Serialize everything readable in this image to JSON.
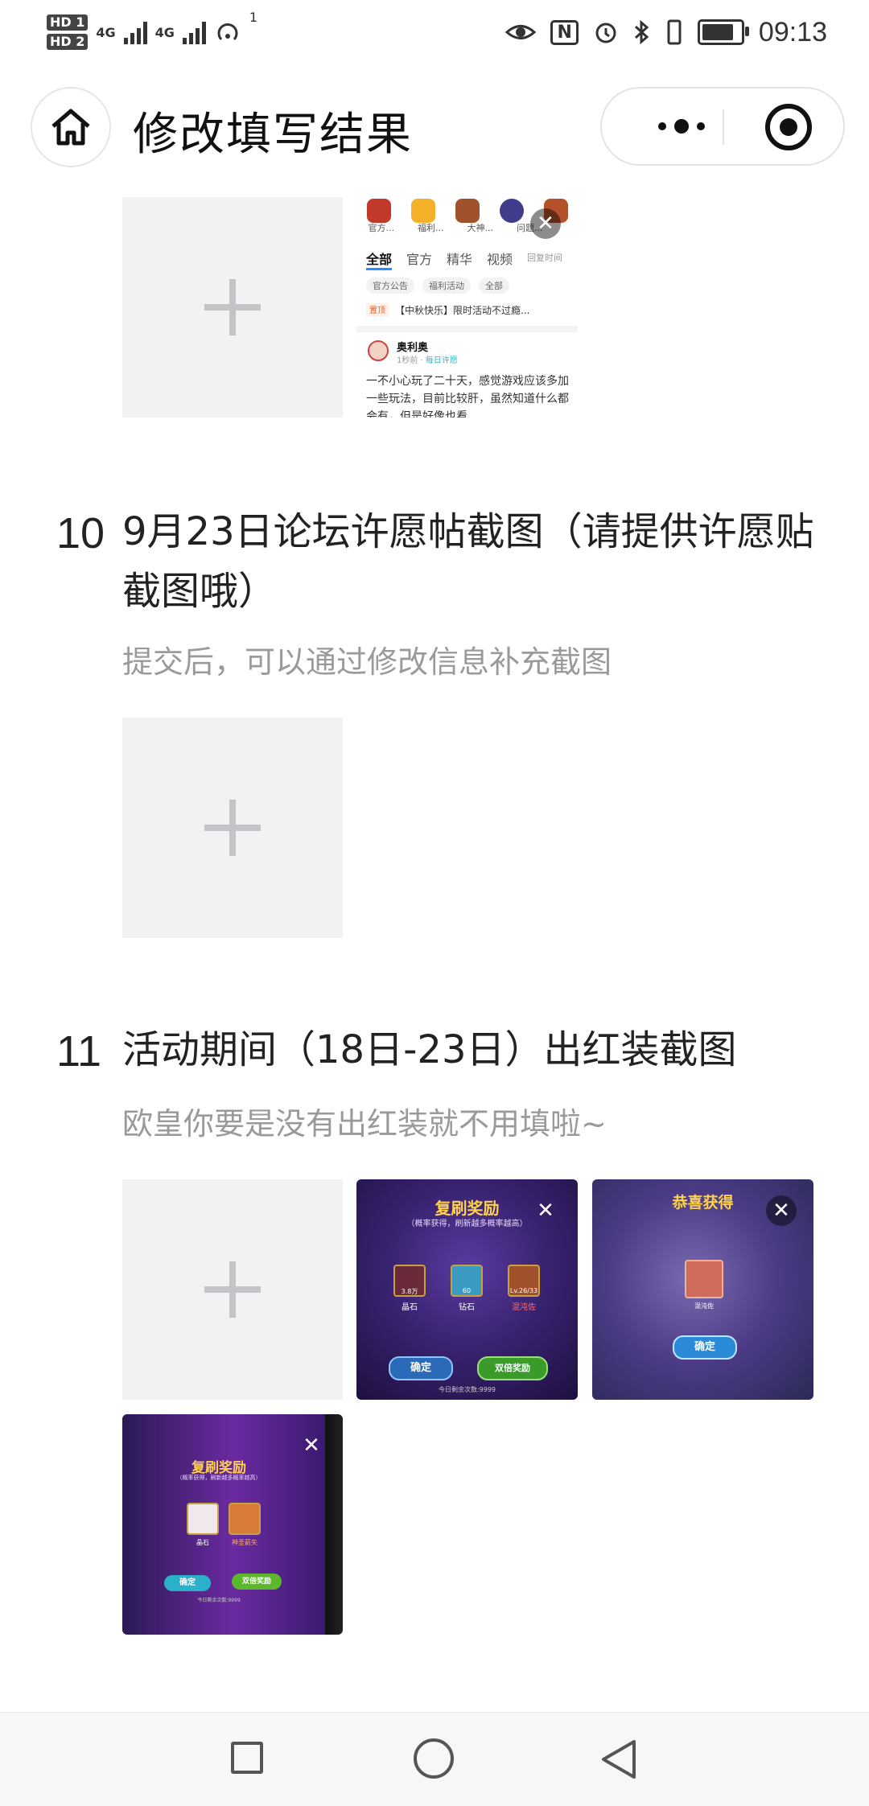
{
  "status_bar": {
    "sim1": "HD 1",
    "sim2": "HD 2",
    "net1": "4G",
    "net2": "4G",
    "hotspot_count": "1",
    "nfc": "N",
    "time": "09:13",
    "icons": [
      "eye-icon",
      "nfc-icon",
      "alarm-icon",
      "bluetooth-icon",
      "vibrate-icon",
      "battery-icon"
    ]
  },
  "nav": {
    "title": "修改填写结果"
  },
  "forum_thumb": {
    "icon_labels": [
      "官方...",
      "福利...",
      "大神...",
      "问题...",
      ""
    ],
    "tabs": [
      "全部",
      "官方",
      "精华",
      "视频"
    ],
    "sort": "回复时间",
    "chips": [
      "官方公告",
      "福利活动",
      "全部"
    ],
    "pinned_tag": "置顶",
    "pinned_text": "【中秋快乐】限时活动不过瘾...",
    "user": "奥利奥",
    "user_meta_time": "1秒前",
    "user_meta_tag": "每日许愿",
    "body": "一不小心玩了二十天，感觉游戏应该多加一些玩法，目前比较肝，虽然知道什么都会有，但是好像也看"
  },
  "q10": {
    "number": "10",
    "title": "9月23日论坛许愿帖截图（请提供许愿贴截图哦）",
    "desc": "提交后，可以通过修改信息补充截图"
  },
  "q11": {
    "number": "11",
    "title": "活动期间（18日-23日）出红装截图",
    "desc": "欧皇你要是没有出红装就不用填啦~"
  },
  "game_thumbs": {
    "g1": {
      "title": "复刷奖励",
      "sub": "（概率获得，刷新越多概率越高）",
      "items": [
        {
          "name": "晶石",
          "count": "3.8万"
        },
        {
          "name": "钻石",
          "count": "60"
        },
        {
          "name": "混沌佐",
          "count": "Lv.26/33"
        }
      ],
      "confirm": "确定",
      "double": "双倍奖励",
      "footer": "今日剩余次数:9999"
    },
    "g2": {
      "title": "恭喜获得",
      "item_label": "混沌佐",
      "confirm": "确定"
    },
    "g3": {
      "title": "复刷奖励",
      "sub": "（概率获得，刷新越多概率越高）",
      "items": [
        {
          "name": "晶石"
        },
        {
          "name": "神圣箭矢"
        }
      ],
      "confirm": "确定",
      "double": "双倍奖励",
      "footer": "今日剩余次数:9999"
    }
  },
  "colors": {
    "tile_bg": "#f1f2f4",
    "plus": "#c2c4c7",
    "desc_gray": "#9a9a9a"
  }
}
